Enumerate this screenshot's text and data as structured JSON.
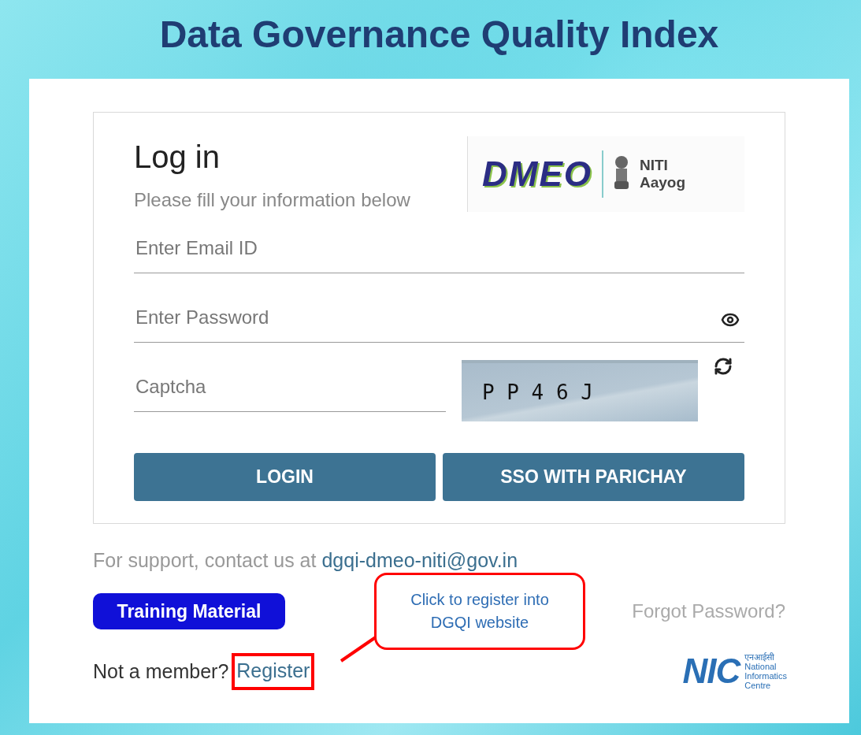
{
  "title": "Data Governance Quality Index",
  "login": {
    "heading": "Log in",
    "subtitle": "Please fill your information below",
    "logos": {
      "dmeo": "DMEO",
      "niti": [
        "NITI",
        "Aayog"
      ]
    },
    "fields": [
      {
        "kind": "text",
        "placeholder": "Enter Email ID"
      },
      {
        "kind": "password",
        "placeholder": "Enter Password"
      }
    ],
    "captcha": {
      "placeholder": "Captcha",
      "code": "P P 4 6 J"
    },
    "buttons": [
      "LOGIN",
      "SSO WITH PARICHAY"
    ]
  },
  "support": {
    "text": "For support, contact us at",
    "email": "dgqi-dmeo-niti@gov.in"
  },
  "training_button": "Training Material",
  "forgot_password": "Forgot Password?",
  "register": {
    "prompt": "Not a member?",
    "link": "Register"
  },
  "callout": {
    "text": "Click to register into DGQI website"
  },
  "nic_logo": {
    "mark": "NIC",
    "hindi": "एनआईसी",
    "lines": [
      "National",
      "Informatics",
      "Centre"
    ]
  }
}
